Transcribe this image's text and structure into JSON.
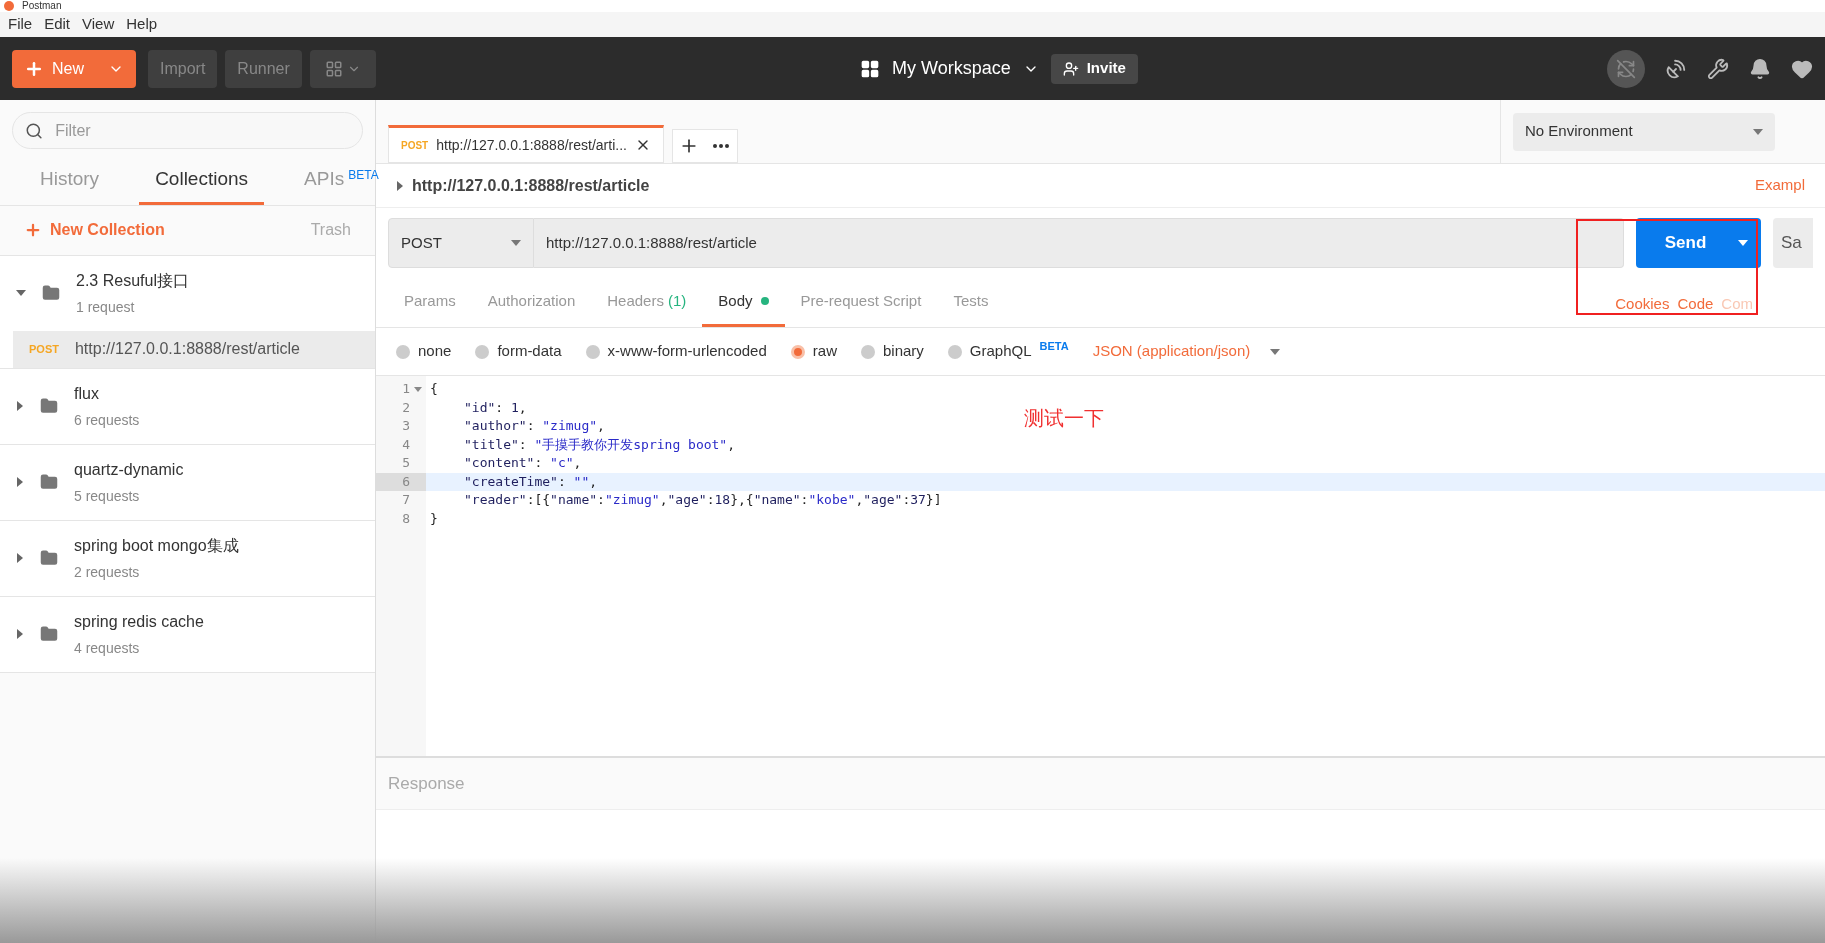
{
  "window": {
    "title": "Postman"
  },
  "menu": [
    "File",
    "Edit",
    "View",
    "Help"
  ],
  "header": {
    "new_button": "New",
    "import_button": "Import",
    "runner_button": "Runner",
    "workspace": "My Workspace",
    "invite": "Invite"
  },
  "sidebar": {
    "filter_placeholder": "Filter",
    "tabs": [
      {
        "label": "History",
        "selected": false
      },
      {
        "label": "Collections",
        "selected": true
      },
      {
        "label": "APIs",
        "badge": "BETA",
        "selected": false
      }
    ],
    "new_collection": "New Collection",
    "trash": "Trash",
    "collections": [
      {
        "name": "2.3 Resuful接口",
        "count": "1 request",
        "expanded": true,
        "children": [
          {
            "method": "POST",
            "url": "http://127.0.0.1:8888/rest/article",
            "selected": true
          }
        ]
      },
      {
        "name": "flux",
        "count": "6 requests",
        "expanded": false
      },
      {
        "name": "quartz-dynamic",
        "count": "5 requests",
        "expanded": false
      },
      {
        "name": "spring boot mongo集成",
        "count": "2 requests",
        "expanded": false
      },
      {
        "name": "spring redis cache",
        "count": "4 requests",
        "expanded": false
      }
    ]
  },
  "request_tabs": [
    {
      "method": "POST",
      "title": "http://127.0.0.1:8888/rest/arti...",
      "selected": true
    }
  ],
  "environment": "No Environment",
  "request": {
    "name": "http://127.0.0.1:8888/rest/article",
    "examples": "Exampl",
    "method": "POST",
    "url": "http://127.0.0.1:8888/rest/article",
    "send": "Send",
    "save": "Sa"
  },
  "section_tabs": [
    {
      "label": "Params",
      "selected": false
    },
    {
      "label": "Authorization",
      "selected": false
    },
    {
      "label": "Headers",
      "count": "(1)",
      "selected": false
    },
    {
      "label": "Body",
      "dot": true,
      "selected": true
    },
    {
      "label": "Pre-request Script",
      "selected": false
    },
    {
      "label": "Tests",
      "selected": false
    }
  ],
  "side_links": [
    {
      "label": "Cookies",
      "disabled": false
    },
    {
      "label": "Code",
      "disabled": false
    },
    {
      "label": "Com",
      "disabled": true
    }
  ],
  "body_types": [
    {
      "label": "none",
      "selected": false
    },
    {
      "label": "form-data",
      "selected": false
    },
    {
      "label": "x-www-form-urlencoded",
      "selected": false
    },
    {
      "label": "raw",
      "selected": true
    },
    {
      "label": "binary",
      "selected": false
    },
    {
      "label": "GraphQL",
      "badge": "BETA",
      "selected": false
    }
  ],
  "format": "JSON (application/json)",
  "editor": [
    {
      "number": "1",
      "foldable": true,
      "indent": false,
      "highlighted": false,
      "tokens": [
        {
          "kind": "punct",
          "text": "{"
        }
      ]
    },
    {
      "number": "2",
      "indent": true,
      "highlighted": false,
      "tokens": [
        {
          "kind": "key",
          "text": "\"id\""
        },
        {
          "kind": "punct",
          "text": ": "
        },
        {
          "kind": "number",
          "text": "1"
        },
        {
          "kind": "punct",
          "text": ","
        }
      ]
    },
    {
      "number": "3",
      "indent": true,
      "highlighted": false,
      "tokens": [
        {
          "kind": "key",
          "text": "\"author\""
        },
        {
          "kind": "punct",
          "text": ": "
        },
        {
          "kind": "string",
          "text": "\"zimug\""
        },
        {
          "kind": "punct",
          "text": ","
        }
      ]
    },
    {
      "number": "4",
      "indent": true,
      "highlighted": false,
      "tokens": [
        {
          "kind": "key",
          "text": "\"title\""
        },
        {
          "kind": "punct",
          "text": ": "
        },
        {
          "kind": "string",
          "text": "\"手摸手教你开发spring boot\""
        },
        {
          "kind": "punct",
          "text": ","
        }
      ]
    },
    {
      "number": "5",
      "indent": true,
      "highlighted": false,
      "tokens": [
        {
          "kind": "key",
          "text": "\"content\""
        },
        {
          "kind": "punct",
          "text": ": "
        },
        {
          "kind": "string",
          "text": "\"c\""
        },
        {
          "kind": "punct",
          "text": ","
        }
      ]
    },
    {
      "number": "6",
      "indent": true,
      "highlighted": true,
      "tokens": [
        {
          "kind": "key",
          "text": "\"createTime\""
        },
        {
          "kind": "punct",
          "text": ": "
        },
        {
          "kind": "string",
          "text": "\"\""
        },
        {
          "kind": "punct",
          "text": ","
        }
      ]
    },
    {
      "number": "7",
      "indent": true,
      "highlighted": false,
      "tokens": [
        {
          "kind": "key",
          "text": "\"reader\""
        },
        {
          "kind": "punct",
          "text": ":[{"
        },
        {
          "kind": "key",
          "text": "\"name\""
        },
        {
          "kind": "punct",
          "text": ":"
        },
        {
          "kind": "string",
          "text": "\"zimug\""
        },
        {
          "kind": "punct",
          "text": ","
        },
        {
          "kind": "key",
          "text": "\"age\""
        },
        {
          "kind": "punct",
          "text": ":"
        },
        {
          "kind": "number",
          "text": "18"
        },
        {
          "kind": "punct",
          "text": "},{"
        },
        {
          "kind": "key",
          "text": "\"name\""
        },
        {
          "kind": "punct",
          "text": ":"
        },
        {
          "kind": "string",
          "text": "\"kobe\""
        },
        {
          "kind": "punct",
          "text": ","
        },
        {
          "kind": "key",
          "text": "\"age\""
        },
        {
          "kind": "punct",
          "text": ":"
        },
        {
          "kind": "number",
          "text": "37"
        },
        {
          "kind": "punct",
          "text": "}]"
        }
      ]
    },
    {
      "number": "8",
      "indent": false,
      "highlighted": false,
      "tokens": [
        {
          "kind": "punct",
          "text": "}"
        }
      ]
    }
  ],
  "annotation": "测试一下",
  "response": {
    "label": "Response"
  }
}
